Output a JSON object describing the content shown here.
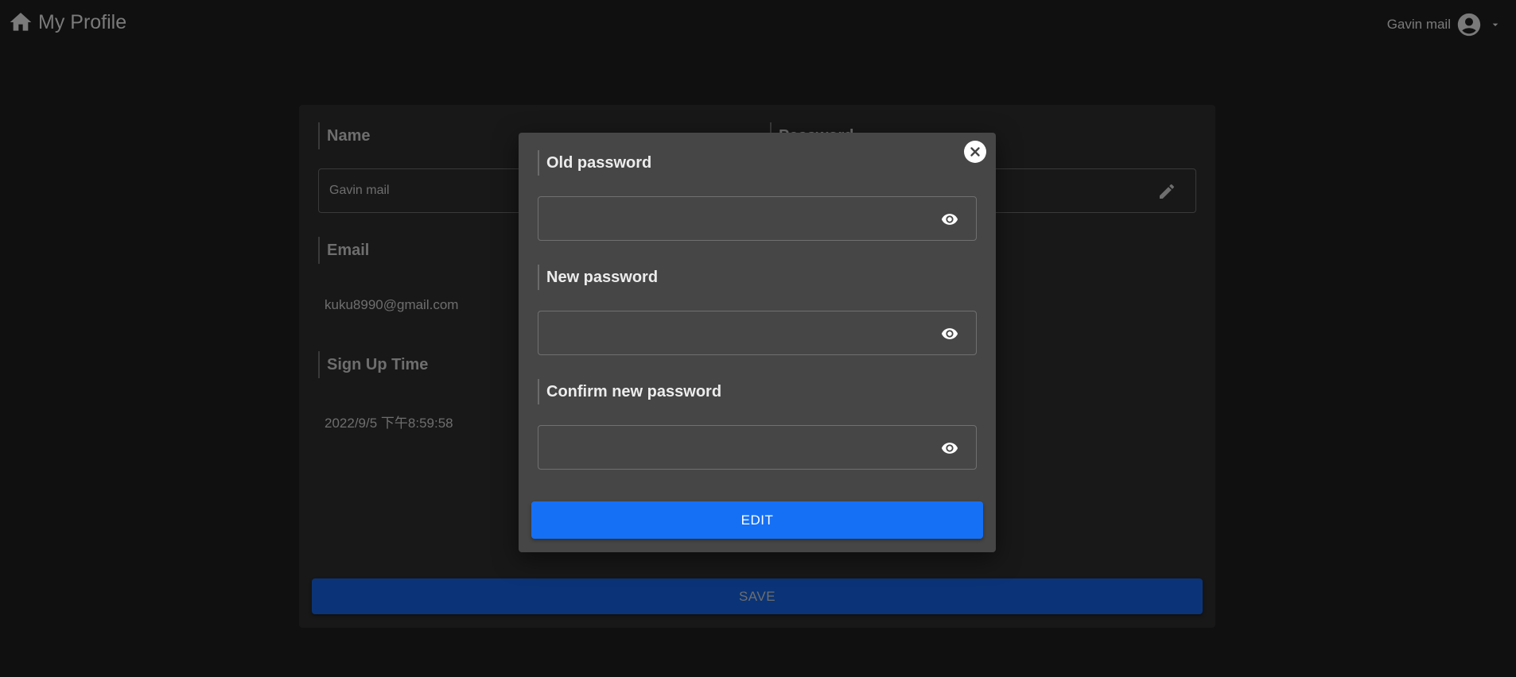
{
  "header": {
    "title": "My Profile",
    "user_name": "Gavin mail"
  },
  "profile": {
    "name_label": "Name",
    "name_value": "Gavin mail",
    "password_label": "Password",
    "email_label": "Email",
    "email_value": "kuku8990@gmail.com",
    "signup_label": "Sign Up Time",
    "signup_value": "2022/9/5 下午8:59:58",
    "save_label": "SAVE"
  },
  "modal": {
    "fields": [
      {
        "label": "Old password",
        "value": ""
      },
      {
        "label": "New password",
        "value": ""
      },
      {
        "label": "Confirm new password",
        "value": ""
      }
    ],
    "edit_label": "EDIT"
  },
  "colors": {
    "primary": "#1570f6",
    "save_disabled": "#0a3477",
    "background": "#101010",
    "card": "#181818",
    "modal": "#464646"
  }
}
